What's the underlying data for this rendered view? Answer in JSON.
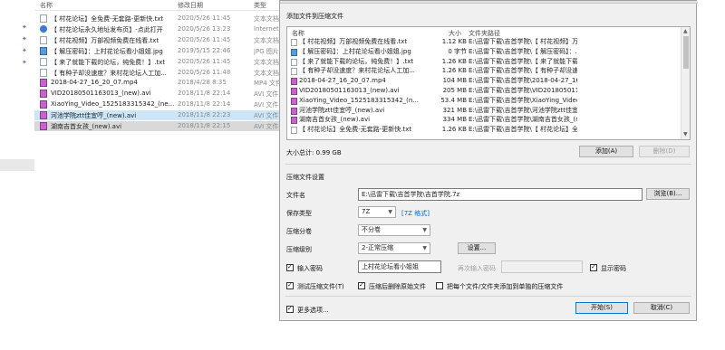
{
  "explorer": {
    "columns": {
      "name": "名称",
      "date": "修改日期",
      "type": "类型"
    },
    "files": [
      {
        "icon": "txt-icon",
        "name": "【 村花论坛】全免费-无套路-更新快.txt",
        "date": "2020/5/26 11:45",
        "type": "文本文档"
      },
      {
        "icon": "ie-icon",
        "name": "【 村花论坛永久地址发布页】-点此打开",
        "date": "2020/5/26 13:23",
        "type": "Internet"
      },
      {
        "icon": "txt-icon",
        "name": "【 村花视频】万部视频免费在线看.txt",
        "date": "2020/5/26 11:45",
        "type": "文本文档"
      },
      {
        "icon": "jpg-icon",
        "name": "【 解压密码】：上村花论坛看小姐姐.jpg",
        "date": "2019/5/15 22:46",
        "type": "JPG 图片"
      },
      {
        "icon": "txt-icon",
        "name": "【 来了就能下载的论坛，纯免费！】.txt",
        "date": "2020/5/26 11:45",
        "type": "文本文档"
      },
      {
        "icon": "txt-icon",
        "name": "【 有种子却没速度？来村花论坛人工加...",
        "date": "2020/5/26 11:48",
        "type": "文本文档"
      },
      {
        "icon": "mp4-icon",
        "name": "2018-04-27_16_20_07.mp4",
        "date": "2018/4/28 8:35",
        "type": "MP4 文件"
      },
      {
        "icon": "avi-icon",
        "name": "VID20180501163013_(new).avi",
        "date": "2018/11/8 22:14",
        "type": "AVI 文件"
      },
      {
        "icon": "avi-icon",
        "name": "XiaoYing_Video_1525183315342_(ne...",
        "date": "2018/11/8 22:14",
        "type": "AVI 文件"
      },
      {
        "icon": "avi-icon",
        "name": "河池学院ztt佳宜哼_(new).avi",
        "date": "2018/11/8 22:23",
        "type": "AVI 文件"
      },
      {
        "icon": "avi-icon",
        "name": "湖南吉首女孩_(new).avi",
        "date": "2018/11/8 22:15",
        "type": "AVI 文件"
      }
    ]
  },
  "dialog": {
    "section1_title": "添加文件到压缩文件",
    "list_headers": {
      "name": "名称",
      "size": "大小",
      "path": "文件夹路径"
    },
    "items": [
      {
        "icon": "txt-icon",
        "name": "【 村花视频】万部视频免费在线看.txt",
        "size": "1.12 KB",
        "path": "E:\\迅雷下载\\吉首学院\\【 村花视频】万..."
      },
      {
        "icon": "jpg-icon",
        "name": "【 解压密码】：上村花论坛看小姐姐.jpg",
        "size": "0 字节",
        "path": "E:\\迅雷下载\\吉首学院\\【 解压密码】：..."
      },
      {
        "icon": "txt-icon",
        "name": "【 来了就能下载的论坛，纯免费！】.txt",
        "size": "1.26 KB",
        "path": "E:\\迅雷下载\\吉首学院\\【 来了就能下载..."
      },
      {
        "icon": "txt-icon",
        "name": "【 有种子却没速度？来村花论坛人工加...",
        "size": "1.26 KB",
        "path": "E:\\迅雷下载\\吉首学院\\【 有种子却没速..."
      },
      {
        "icon": "mp4-icon",
        "name": "2018-04-27_16_20_07.mp4",
        "size": "104 MB",
        "path": "E:\\迅雷下载\\吉首学院\\2018-04-27_16_2..."
      },
      {
        "icon": "avi-icon",
        "name": "VID20180501163013_(new).avi",
        "size": "205 MB",
        "path": "E:\\迅雷下载\\吉首学院\\VID201805011..."
      },
      {
        "icon": "avi-icon",
        "name": "XiaoYing_Video_1525183315342_(n...",
        "size": "53.4 MB",
        "path": "E:\\迅雷下载\\吉首学院\\XiaoYing_Video..."
      },
      {
        "icon": "avi-icon",
        "name": "河池学院ztt佳宜哼_(new).avi",
        "size": "321 MB",
        "path": "E:\\迅雷下载\\吉首学院\\河池学院ztt佳宜..."
      },
      {
        "icon": "avi-icon",
        "name": "湖南吉首女孩_(new).avi",
        "size": "334 MB",
        "path": "E:\\迅雷下载\\吉首学院\\湖南吉首女孩_(n..."
      },
      {
        "icon": "txt-icon",
        "name": "【 村花论坛】全免费-无套路-更新快.txt",
        "size": "1.26 KB",
        "path": "E:\\迅雷下载\\吉首学院\\【 村花论坛】全..."
      }
    ],
    "total_size": "大小总计: 0.99 GB",
    "add_button": "添加(A)",
    "delete_button": "删除(D)",
    "section2_title": "压缩文件设置",
    "filename_label": "文件名",
    "filename_value": "E:\\迅雷下载\\吉首学院\\吉首学院.7z",
    "browse_button": "浏览(B)...",
    "savetype_label": "保存类型",
    "savetype_value": "7Z",
    "savetype_link": "[7Z 格式]",
    "split_label": "压缩分卷",
    "split_value": "不分卷",
    "level_label": "压缩级别",
    "level_value": "2-正常压缩",
    "settings_button": "设置...",
    "password_checkbox": "输入密码",
    "password_value": "上村花论坛看小姐姐",
    "confirm_label": "再次输入密码",
    "show_password": "显示密码",
    "test_checkbox": "测试压缩文件(T)",
    "delete_after": "压缩后删除原始文件",
    "separate_archive": "把每个文件/文件夹添加到单独的压缩文件",
    "more_options": "更多选项...",
    "start_button": "开始(S)",
    "cancel_button": "取消(C)"
  }
}
